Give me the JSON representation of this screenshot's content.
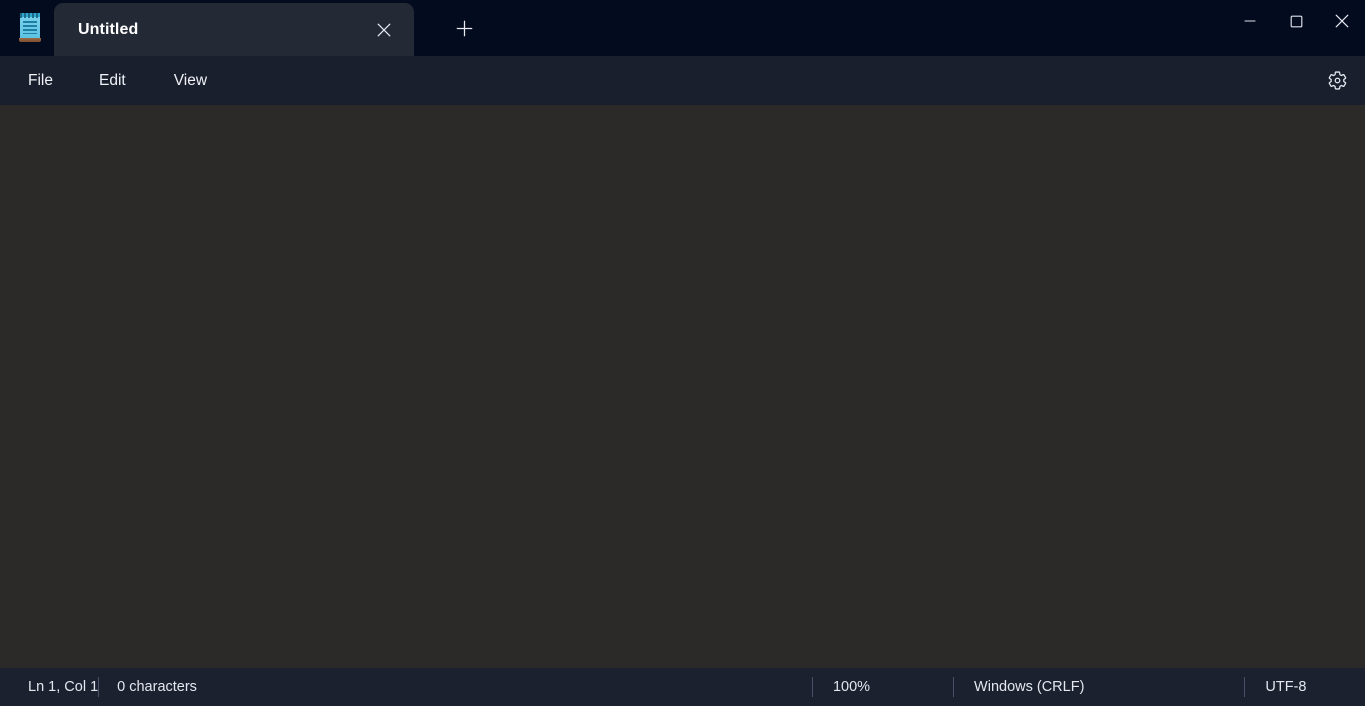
{
  "window": {
    "app_icon": "notepad-icon",
    "controls": {
      "minimize": "minimize-icon",
      "maximize": "maximize-icon",
      "close": "close-icon"
    }
  },
  "tabs": {
    "items": [
      {
        "title": "Untitled",
        "active": true,
        "close_icon": "close-icon"
      }
    ],
    "new_tab_icon": "plus-icon"
  },
  "menubar": {
    "items": [
      {
        "label": "File"
      },
      {
        "label": "Edit"
      },
      {
        "label": "View"
      }
    ],
    "settings_icon": "gear-icon"
  },
  "editor": {
    "content": "",
    "placeholder": ""
  },
  "statusbar": {
    "cursor_position": "Ln 1, Col 1",
    "character_count": "0 characters",
    "zoom": "100%",
    "line_ending": "Windows (CRLF)",
    "encoding": "UTF-8"
  },
  "colors": {
    "titlebar_bg": "#030b1e",
    "tab_active_bg": "#242936",
    "menubar_bg": "#1a1f2e",
    "editor_bg": "#2b2a28",
    "statusbar_bg": "#1c2130",
    "text_primary": "#ffffff",
    "divider": "#4a5168"
  }
}
